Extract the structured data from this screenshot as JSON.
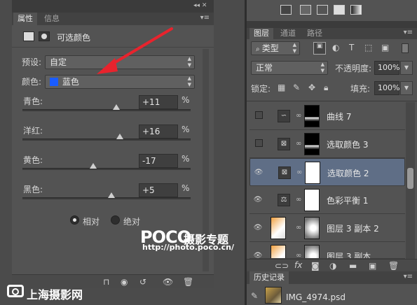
{
  "props_panel": {
    "tabs": [
      "属性",
      "信息"
    ],
    "title": "可选颜色",
    "preset_label": "预设:",
    "preset_value": "自定",
    "color_label": "颜色:",
    "color_value": "蓝色",
    "color_swatch": "#1a5cff",
    "sliders": [
      {
        "label": "青色:",
        "value": "+11",
        "unit": "%",
        "level": 0.56
      },
      {
        "label": "洋红:",
        "value": "+16",
        "unit": "%",
        "level": 0.58
      },
      {
        "label": "黄色:",
        "value": "-17",
        "unit": "%",
        "level": 0.42
      },
      {
        "label": "黑色:",
        "value": "+5",
        "unit": "%",
        "level": 0.53
      }
    ],
    "radio_relative": "相对",
    "radio_absolute": "绝对"
  },
  "layers_panel": {
    "tabs": [
      "图层",
      "通道",
      "路径"
    ],
    "kind_filter": "类型",
    "blend_mode": "正常",
    "opacity_label": "不透明度:",
    "opacity_value": "100%",
    "lock_label": "锁定:",
    "fill_label": "填充:",
    "fill_value": "100%",
    "layers": [
      {
        "name": "曲线 7",
        "adj_icon": "curves-icon",
        "visible": false
      },
      {
        "name": "选取颜色 3",
        "adj_icon": "selective-color-icon",
        "visible": false
      },
      {
        "name": "选取颜色 2",
        "adj_icon": "selective-color-icon",
        "visible": true,
        "selected": true
      },
      {
        "name": "色彩平衡 1",
        "adj_icon": "balance-icon",
        "visible": true
      },
      {
        "name": "图层 3 副本 2",
        "adj_icon": "photo-thumb",
        "visible": true
      },
      {
        "name": "图层 3 副本",
        "adj_icon": "photo-thumb",
        "visible": true
      }
    ]
  },
  "history_panel": {
    "tab": "历史记录",
    "item": "IMG_4974.psd"
  },
  "watermarks": {
    "poco_logo": "POCO",
    "poco_title": "摄影专题",
    "poco_url": "http://photo.poco.cn/",
    "shanghai": "上海摄影网"
  },
  "accent_colors": {
    "arrow": "#e8232d",
    "selected_layer": "#5f6e86"
  }
}
